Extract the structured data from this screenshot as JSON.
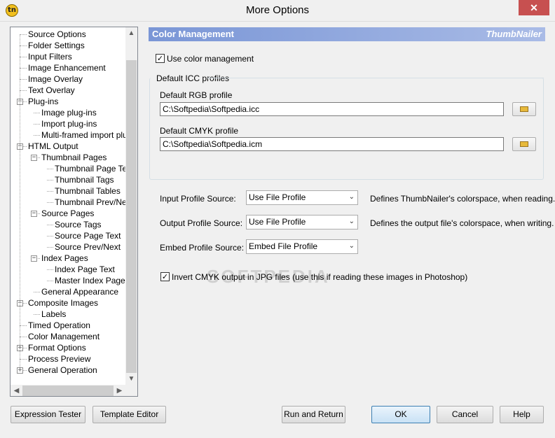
{
  "window": {
    "title": "More Options",
    "app_icon_text": "tn",
    "close_glyph": "✕"
  },
  "tree": {
    "items": [
      {
        "label": "Source Options",
        "level": 0
      },
      {
        "label": "Folder Settings",
        "level": 0
      },
      {
        "label": "Input Filters",
        "level": 0
      },
      {
        "label": "Image Enhancement",
        "level": 0
      },
      {
        "label": "Image Overlay",
        "level": 0
      },
      {
        "label": "Text Overlay",
        "level": 0
      },
      {
        "label": "Plug-ins",
        "level": 0,
        "expander": "−"
      },
      {
        "label": "Image plug-ins",
        "level": 1
      },
      {
        "label": "Import plug-ins",
        "level": 1
      },
      {
        "label": "Multi-framed import plug-ins",
        "level": 1
      },
      {
        "label": "HTML Output",
        "level": 0,
        "expander": "−"
      },
      {
        "label": "Thumbnail Pages",
        "level": 1,
        "expander": "−"
      },
      {
        "label": "Thumbnail Page Text",
        "level": 2
      },
      {
        "label": "Thumbnail Tags",
        "level": 2
      },
      {
        "label": "Thumbnail Tables",
        "level": 2
      },
      {
        "label": "Thumbnail Prev/Next",
        "level": 2
      },
      {
        "label": "Source Pages",
        "level": 1,
        "expander": "−"
      },
      {
        "label": "Source Tags",
        "level": 2
      },
      {
        "label": "Source Page Text",
        "level": 2
      },
      {
        "label": "Source Prev/Next",
        "level": 2
      },
      {
        "label": "Index Pages",
        "level": 1,
        "expander": "−"
      },
      {
        "label": "Index Page Text",
        "level": 2
      },
      {
        "label": "Master Index Page",
        "level": 2
      },
      {
        "label": "General Appearance",
        "level": 1
      },
      {
        "label": "Composite Images",
        "level": 0,
        "expander": "−"
      },
      {
        "label": "Labels",
        "level": 1
      },
      {
        "label": "Timed Operation",
        "level": 0
      },
      {
        "label": "Color Management",
        "level": 0,
        "selected": true
      },
      {
        "label": "Format Options",
        "level": 0,
        "expander": "+"
      },
      {
        "label": "Process Preview",
        "level": 0
      },
      {
        "label": "General Operation",
        "level": 0,
        "expander": "+"
      }
    ],
    "scroll_up": "▲",
    "scroll_down": "▼",
    "scroll_left": "◀",
    "scroll_right": "▶"
  },
  "panel": {
    "title": "Color Management",
    "brand": "ThumbNailer",
    "use_color_management": {
      "label": "Use color management",
      "checked": true
    },
    "group_title": "Default ICC profiles",
    "rgb": {
      "label": "Default RGB profile",
      "value": "C:\\Softpedia\\Softpedia.icc"
    },
    "cmyk": {
      "label": "Default CMYK profile",
      "value": "C:\\Softpedia\\Softpedia.icm"
    },
    "input_source": {
      "label": "Input Profile Source:",
      "value": "Use File Profile",
      "description": "Defines ThumbNailer's colorspace, when reading."
    },
    "output_source": {
      "label": "Output Profile Source:",
      "value": "Use File Profile",
      "description": "Defines the output file's colorspace, when writing."
    },
    "embed_source": {
      "label": "Embed Profile Source:",
      "value": "Embed File Profile"
    },
    "invert_cmyk": {
      "label": "Invert CMYK output in JPG files (use this if reading these images in Photoshop)",
      "checked": true
    },
    "watermark": "SOFTPEDIA"
  },
  "buttons": {
    "expression_tester": "Expression Tester",
    "template_editor": "Template Editor",
    "run_and_return": "Run and Return",
    "ok": "OK",
    "cancel": "Cancel",
    "help": "Help"
  },
  "icons": {
    "check": "✓",
    "dropdown": "⌄"
  }
}
